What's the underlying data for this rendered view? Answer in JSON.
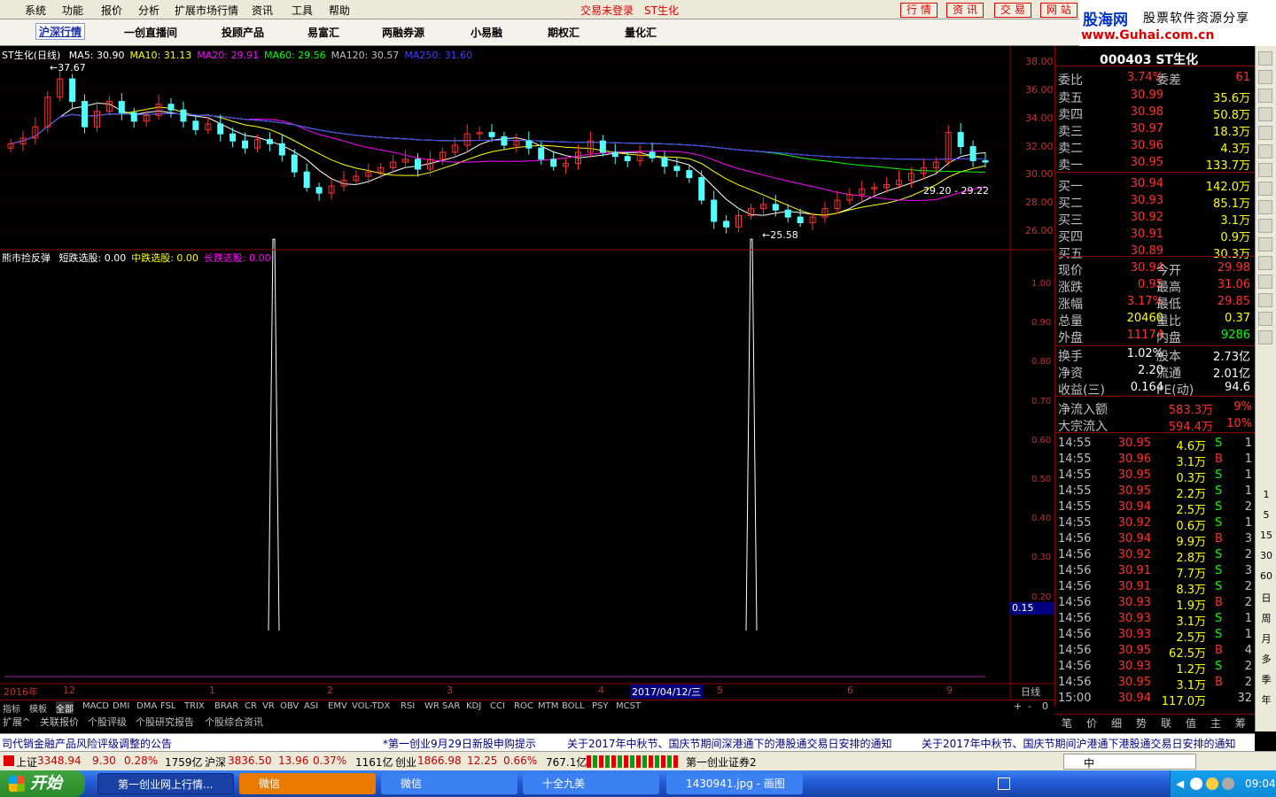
{
  "menu": [
    "系统",
    "功能",
    "报价",
    "分析",
    "扩展市场行情",
    "资讯",
    "工具",
    "帮助"
  ],
  "center_msg": [
    "交易未登录",
    "ST生化"
  ],
  "right_buttons": [
    "行 情",
    "资 讯",
    "交 易",
    "网 站"
  ],
  "logo": {
    "brand": "股海网",
    "slogan": "股票软件资源分享",
    "url": "www.Guhai.com.cn"
  },
  "tabs": [
    "沪深行情",
    "一创直播间",
    "投顾产品",
    "易富汇",
    "两融券源",
    "小易融",
    "期权汇",
    "量化汇"
  ],
  "chart_title": {
    "name": "ST生化(日线)",
    "ma": [
      {
        "label": "MA5: 30.90",
        "color": "#ffffff"
      },
      {
        "label": "MA10: 31.13",
        "color": "#ffff00"
      },
      {
        "label": "MA20: 29.91",
        "color": "#ff00ff"
      },
      {
        "label": "MA60: 29.56",
        "color": "#00ff00"
      },
      {
        "label": "MA120: 30.57",
        "color": "#c0c0c0"
      },
      {
        "label": "MA250: 31.60",
        "color": "#4040ff"
      }
    ]
  },
  "chart_annotations": {
    "high": "37.67",
    "low": "25.58",
    "range": "29.20 - 29.22"
  },
  "indicator_title": {
    "name": "熊市捡反弹",
    "items": [
      {
        "label": "短跌选股: 0.00",
        "color": "#ffffff"
      },
      {
        "label": "中跌选股: 0.00",
        "color": "#ffff00"
      },
      {
        "label": "长跌选股: 0.00",
        "color": "#ff00ff"
      }
    ]
  },
  "price_axis": [
    "38.00",
    "36.00",
    "34.00",
    "32.00",
    "30.00",
    "28.00",
    "26.00"
  ],
  "ind_axis": [
    "1.00",
    "0.90",
    "0.80",
    "0.70",
    "0.60",
    "0.50",
    "0.40",
    "0.30",
    "0.20"
  ],
  "ind_cursor": "0.15",
  "date_axis": {
    "year": "2016年",
    "months": [
      "12",
      "1",
      "2",
      "3",
      "4",
      "5",
      "6",
      "9"
    ],
    "cursor_date": "2017/04/12/三",
    "period": "日线"
  },
  "bottom_tabs": [
    "指标",
    "模板",
    "全部",
    "MACD",
    "DMI",
    "DMA",
    "FSL",
    "TRIX",
    "BRAR",
    "CR",
    "VR",
    "OBV",
    "ASI",
    "EMV",
    "VOL-TDX",
    "RSI",
    "WR",
    "SAR",
    "KDJ",
    "CCI",
    "ROC",
    "MTM",
    "BOLL",
    "PSY",
    "MCST"
  ],
  "bottom_tabs2": [
    "扩展^",
    "关联报价",
    "个股评级",
    "个股研究报告",
    "个股综合资讯"
  ],
  "zoom_controls": [
    "+",
    "-",
    "0"
  ],
  "quote": {
    "code": "000403 ST生化",
    "weibi": {
      "label": "委比",
      "value": "3.74%",
      "label2": "委差",
      "value2": "61"
    },
    "sell": [
      {
        "label": "卖五",
        "price": "30.99",
        "vol": "35.6万"
      },
      {
        "label": "卖四",
        "price": "30.98",
        "vol": "50.8万"
      },
      {
        "label": "卖三",
        "price": "30.97",
        "vol": "18.3万"
      },
      {
        "label": "卖二",
        "price": "30.96",
        "vol": "4.3万"
      },
      {
        "label": "卖一",
        "price": "30.95",
        "vol": "133.7万"
      }
    ],
    "buy": [
      {
        "label": "买一",
        "price": "30.94",
        "vol": "142.0万"
      },
      {
        "label": "买二",
        "price": "30.93",
        "vol": "85.1万"
      },
      {
        "label": "买三",
        "price": "30.92",
        "vol": "3.1万"
      },
      {
        "label": "买四",
        "price": "30.91",
        "vol": "0.9万"
      },
      {
        "label": "买五",
        "price": "30.89",
        "vol": "30.3万"
      }
    ],
    "stats": [
      {
        "l1": "现价",
        "v1": "30.94",
        "l2": "今开",
        "v2": "29.98",
        "c1": "#ff3030",
        "c2": "#ff3030"
      },
      {
        "l1": "涨跌",
        "v1": "0.95",
        "l2": "最高",
        "v2": "31.06",
        "c1": "#ff3030",
        "c2": "#ff3030"
      },
      {
        "l1": "涨幅",
        "v1": "3.17%",
        "l2": "最低",
        "v2": "29.85",
        "c1": "#ff3030",
        "c2": "#ff3030"
      },
      {
        "l1": "总量",
        "v1": "20460",
        "l2": "量比",
        "v2": "0.37",
        "c1": "#ffff00",
        "c2": "#ffff00"
      },
      {
        "l1": "外盘",
        "v1": "11174",
        "l2": "内盘",
        "v2": "9286",
        "c1": "#ff3030",
        "c2": "#00ff00"
      },
      {
        "l1": "换手",
        "v1": "1.02%",
        "l2": "股本",
        "v2": "2.73亿",
        "c1": "#ffffff",
        "c2": "#ffffff"
      },
      {
        "l1": "净资",
        "v1": "2.20",
        "l2": "流通",
        "v2": "2.01亿",
        "c1": "#ffffff",
        "c2": "#ffffff"
      },
      {
        "l1": "收益(三)",
        "v1": "0.164",
        "l2": "PE(动)",
        "v2": "94.6",
        "c1": "#ffffff",
        "c2": "#ffffff"
      }
    ],
    "flow": [
      {
        "label": "净流入额",
        "value": "583.3万",
        "pct": "9%"
      },
      {
        "label": "大宗流入",
        "value": "594.4万",
        "pct": "10%"
      }
    ],
    "ticks": [
      {
        "t": "14:55",
        "p": "30.95",
        "v": "4.6万",
        "d": "S",
        "n": "1"
      },
      {
        "t": "14:55",
        "p": "30.96",
        "v": "3.1万",
        "d": "B",
        "n": "1"
      },
      {
        "t": "14:55",
        "p": "30.95",
        "v": "0.3万",
        "d": "S",
        "n": "1"
      },
      {
        "t": "14:55",
        "p": "30.95",
        "v": "2.2万",
        "d": "S",
        "n": "1"
      },
      {
        "t": "14:55",
        "p": "30.94",
        "v": "2.5万",
        "d": "S",
        "n": "2"
      },
      {
        "t": "14:55",
        "p": "30.92",
        "v": "0.6万",
        "d": "S",
        "n": "1"
      },
      {
        "t": "14:56",
        "p": "30.94",
        "v": "9.9万",
        "d": "B",
        "n": "3"
      },
      {
        "t": "14:56",
        "p": "30.92",
        "v": "2.8万",
        "d": "S",
        "n": "2"
      },
      {
        "t": "14:56",
        "p": "30.91",
        "v": "7.7万",
        "d": "S",
        "n": "3"
      },
      {
        "t": "14:56",
        "p": "30.91",
        "v": "8.3万",
        "d": "S",
        "n": "2"
      },
      {
        "t": "14:56",
        "p": "30.93",
        "v": "1.9万",
        "d": "B",
        "n": "2"
      },
      {
        "t": "14:56",
        "p": "30.93",
        "v": "3.1万",
        "d": "S",
        "n": "1"
      },
      {
        "t": "14:56",
        "p": "30.93",
        "v": "2.5万",
        "d": "S",
        "n": "1"
      },
      {
        "t": "14:56",
        "p": "30.95",
        "v": "62.5万",
        "d": "B",
        "n": "4"
      },
      {
        "t": "14:56",
        "p": "30.93",
        "v": "1.2万",
        "d": "S",
        "n": "2"
      },
      {
        "t": "14:56",
        "p": "30.95",
        "v": "3.1万",
        "d": "B",
        "n": "2"
      },
      {
        "t": "15:00",
        "p": "30.94",
        "v": "117.0万",
        "d": "",
        "n": "32"
      }
    ],
    "bottom_tabs": [
      "笔",
      "价",
      "细",
      "势",
      "联",
      "值",
      "主",
      "筹"
    ]
  },
  "right_toolbar": [
    "1",
    "5",
    "15",
    "30",
    "60",
    "日",
    "周",
    "月",
    "多",
    "季",
    "年"
  ],
  "ticker": [
    "司代销金融产品风险评级调整的公告",
    "*第一创业9月29日新股申购提示",
    "关于2017年中秋节、国庆节期间深港通下的港股通交易日安排的通知",
    "关于2017年中秋节、国庆节期间沪港通下港股通交易日安排的通知"
  ],
  "status": {
    "sh": {
      "name": "上证",
      "value": "3348.94",
      "chg": "9.30",
      "pct": "0.28%",
      "amt": "1759亿"
    },
    "hs": {
      "name": "沪深",
      "value": "3836.50",
      "chg": "13.96",
      "pct": "0.37%",
      "amt": "1161亿"
    },
    "cy": {
      "name": "创业",
      "value": "1866.98",
      "chg": "12.25",
      "pct": "0.66%",
      "amt": "767.1亿"
    },
    "broker": "第一创业证券2",
    "ime": "中"
  },
  "taskbar": {
    "start": "开始",
    "items": [
      "第一创业网上行情...",
      "微信",
      "微信",
      "十全九美",
      "1430941.jpg - 画图"
    ],
    "time": "09:04"
  },
  "chart_data": {
    "type": "candlestick",
    "ylim": [
      25,
      38.5
    ],
    "markers": {
      "high": 37.67,
      "low": 25.58
    },
    "closes": [
      32.2,
      32.6,
      33.4,
      35.5,
      36.8,
      35.2,
      33.4,
      34.5,
      35.2,
      34.4,
      33.8,
      34.2,
      35.0,
      34.6,
      33.8,
      33.2,
      33.6,
      32.9,
      32.4,
      31.9,
      32.5,
      32.2,
      31.4,
      30.2,
      29.1,
      28.7,
      29.2,
      29.6,
      29.9,
      30.2,
      30.5,
      30.9,
      31.1,
      30.4,
      31.1,
      31.6,
      32.1,
      32.9,
      33.0,
      32.7,
      32.1,
      32.4,
      31.9,
      31.1,
      30.6,
      30.8,
      31.6,
      32.4,
      31.6,
      31.3,
      31.0,
      31.6,
      31.2,
      30.6,
      30.3,
      29.8,
      28.2,
      26.7,
      26.3,
      27.1,
      27.6,
      27.9,
      27.5,
      27.0,
      26.6,
      27.0,
      27.6,
      28.2,
      28.6,
      29.0,
      29.1,
      29.3,
      29.6,
      30.1,
      30.5,
      30.9,
      33.0,
      32.0,
      31.0,
      30.9
    ],
    "ind_spikes": [
      {
        "x": 0.27,
        "y": 1.0
      },
      {
        "x": 0.76,
        "y": 1.0
      }
    ],
    "ind_ylim": [
      0,
      1.05
    ]
  }
}
